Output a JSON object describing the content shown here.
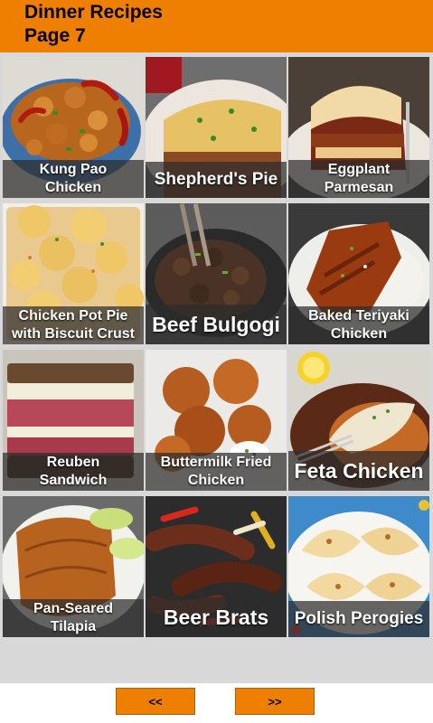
{
  "header": {
    "title_line1": "Dinner Recipes",
    "title_line2": "Page 7"
  },
  "tiles": [
    {
      "label": "Kung Pao\nChicken"
    },
    {
      "label": "Shepherd's Pie"
    },
    {
      "label": "Eggplant\nParmesan"
    },
    {
      "label": "Chicken Pot Pie\nwith Biscuit Crust"
    },
    {
      "label": "Beef Bulgogi"
    },
    {
      "label": "Baked Teriyaki\nChicken"
    },
    {
      "label": "Reuben\nSandwich"
    },
    {
      "label": "Buttermilk Fried\nChicken"
    },
    {
      "label": "Feta Chicken"
    },
    {
      "label": "Pan-Seared\nTilapia"
    },
    {
      "label": "Beer Brats"
    },
    {
      "label": "Polish Perogies"
    }
  ],
  "footer": {
    "prev_label": "<<",
    "next_label": ">>"
  }
}
